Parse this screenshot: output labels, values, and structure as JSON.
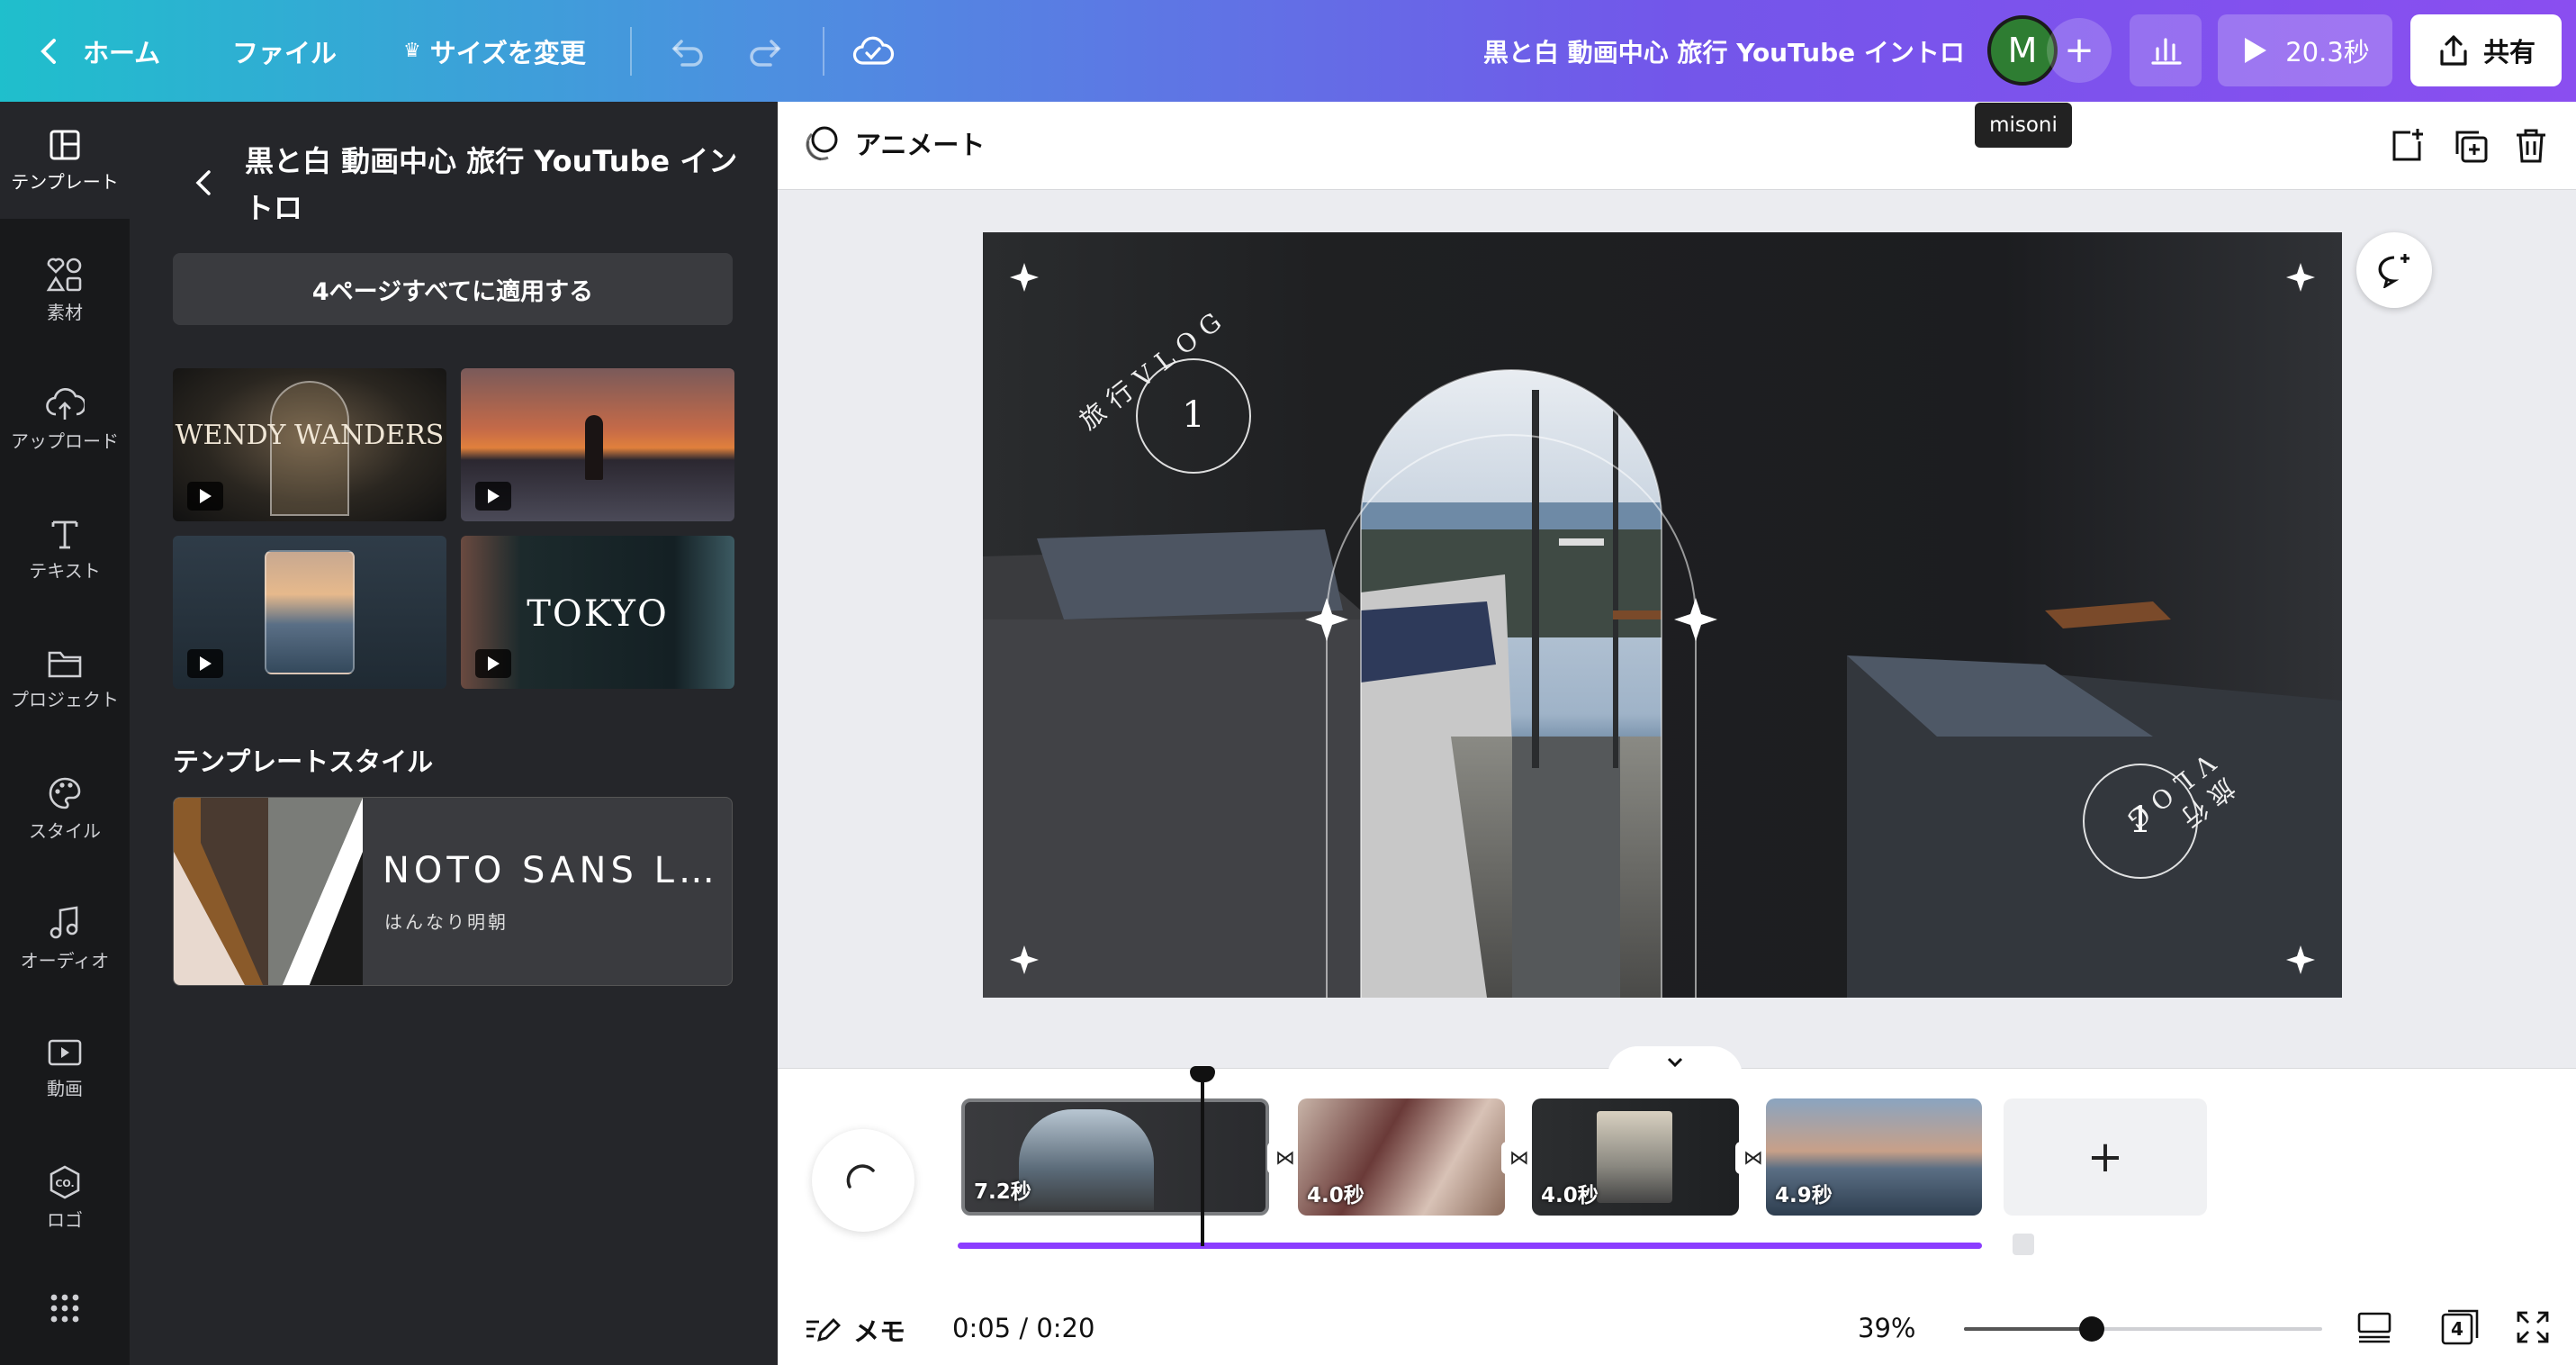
{
  "topbar": {
    "home": "ホーム",
    "file": "ファイル",
    "resize": "サイズを変更",
    "doc_title": "黒と白 動画中心 旅行 YouTube イントロ",
    "avatar_letter": "M",
    "avatar_tooltip": "misoni",
    "play_duration": "20.3秒",
    "share": "共有"
  },
  "rail": {
    "items": [
      {
        "label": "テンプレート",
        "icon": "template-icon"
      },
      {
        "label": "素材",
        "icon": "elements-icon"
      },
      {
        "label": "アップロード",
        "icon": "upload-cloud-icon"
      },
      {
        "label": "テキスト",
        "icon": "text-icon"
      },
      {
        "label": "プロジェクト",
        "icon": "folder-icon"
      },
      {
        "label": "スタイル",
        "icon": "palette-icon"
      },
      {
        "label": "オーディオ",
        "icon": "music-note-icon"
      },
      {
        "label": "動画",
        "icon": "video-icon"
      },
      {
        "label": "ロゴ",
        "icon": "logo-icon"
      }
    ]
  },
  "panel": {
    "title": "黒と白 動画中心 旅行 YouTube イントロ",
    "apply_all": "4ページすべてに適用する",
    "thumbs": [
      {
        "text": "WENDY WANDERS"
      },
      {
        "text": ""
      },
      {
        "text": ""
      },
      {
        "text": "TOKYO"
      }
    ],
    "style_section": "テンプレートスタイル",
    "style_font_main": "NOTO SANS L…",
    "style_font_sub": "はんなり明朝",
    "style_colors": [
      "#e8d9cf",
      "#8a5a2a",
      "#4a3a30",
      "#7a7c78",
      "#ffffff",
      "#1a1a1a"
    ]
  },
  "editor": {
    "animate": "アニメート",
    "canvas_text_top": "旅行VLOG",
    "canvas_num_top": "1",
    "canvas_num_bottom": "1",
    "canvas_text_bottom": "旅行VLOG"
  },
  "timeline": {
    "clips": [
      {
        "label": "7.2秒",
        "selected": true
      },
      {
        "label": "4.0秒",
        "selected": false
      },
      {
        "label": "4.0秒",
        "selected": false
      },
      {
        "label": "4.9秒",
        "selected": false
      }
    ],
    "transition_glyph": "⋈",
    "progress_fraction": 0.25
  },
  "bottombar": {
    "notes": "メモ",
    "time": "0:05 / 0:20",
    "zoom": "39%",
    "page_count": "4"
  },
  "colors": {
    "accent": "#8b3dff",
    "rail_bg": "#18191b",
    "panel_bg": "#25262a"
  }
}
